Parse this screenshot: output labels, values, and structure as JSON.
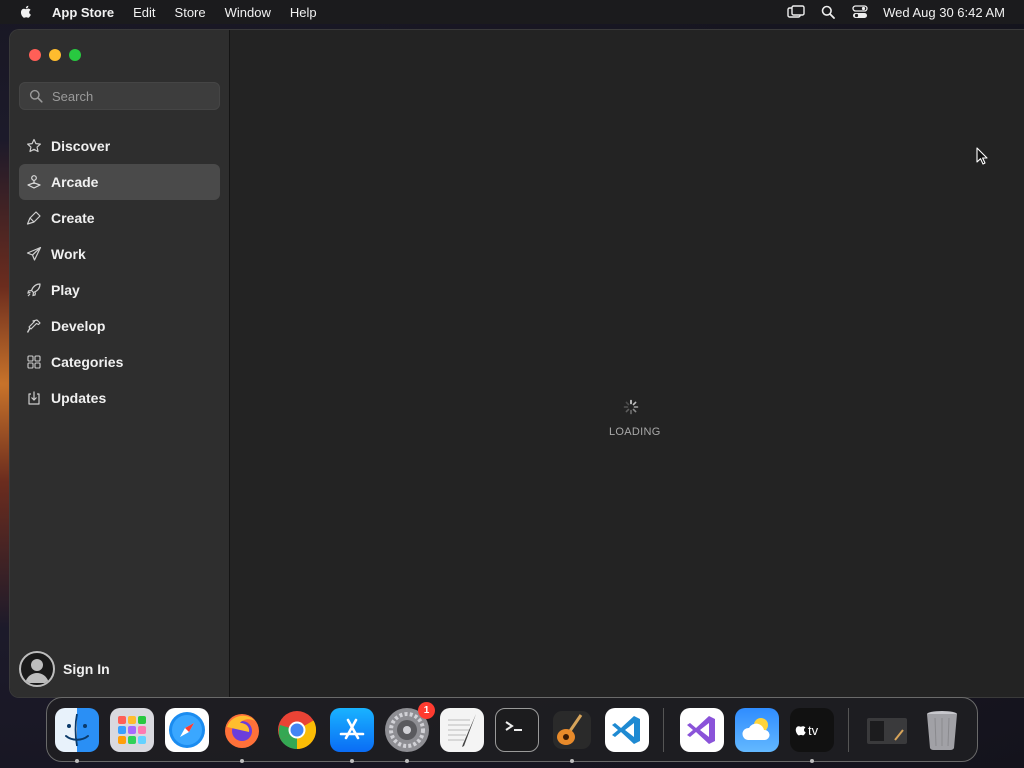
{
  "menubar": {
    "app_name": "App Store",
    "items": [
      "Edit",
      "Store",
      "Window",
      "Help"
    ],
    "clock": "Wed Aug 30  6:42 AM"
  },
  "sidebar": {
    "search_placeholder": "Search",
    "items": [
      {
        "label": "Discover",
        "icon": "star-icon"
      },
      {
        "label": "Arcade",
        "icon": "joystick-icon",
        "active": true
      },
      {
        "label": "Create",
        "icon": "brush-icon"
      },
      {
        "label": "Work",
        "icon": "paper-plane-icon"
      },
      {
        "label": "Play",
        "icon": "rocket-icon"
      },
      {
        "label": "Develop",
        "icon": "hammer-icon"
      },
      {
        "label": "Categories",
        "icon": "grid-icon"
      },
      {
        "label": "Updates",
        "icon": "download-icon"
      }
    ],
    "signin_label": "Sign In"
  },
  "main": {
    "loading_text": "LOADING"
  },
  "dock": {
    "apps": [
      {
        "name": "Finder",
        "running": true
      },
      {
        "name": "Launchpad",
        "running": false
      },
      {
        "name": "Safari",
        "running": false
      },
      {
        "name": "Firefox",
        "running": true
      },
      {
        "name": "Chrome",
        "running": false
      },
      {
        "name": "App Store",
        "running": true
      },
      {
        "name": "System Settings",
        "running": true,
        "badge": "1"
      },
      {
        "name": "TextEdit",
        "running": false
      },
      {
        "name": "Terminal",
        "running": false
      },
      {
        "name": "GarageBand",
        "running": true
      },
      {
        "name": "Visual Studio Code",
        "running": false
      }
    ],
    "apps_right": [
      {
        "name": "Visual Studio",
        "running": false
      },
      {
        "name": "Weather",
        "running": false
      },
      {
        "name": "Apple TV",
        "running": true
      }
    ],
    "trash_area": [
      "Screenshot",
      "Trash"
    ]
  }
}
